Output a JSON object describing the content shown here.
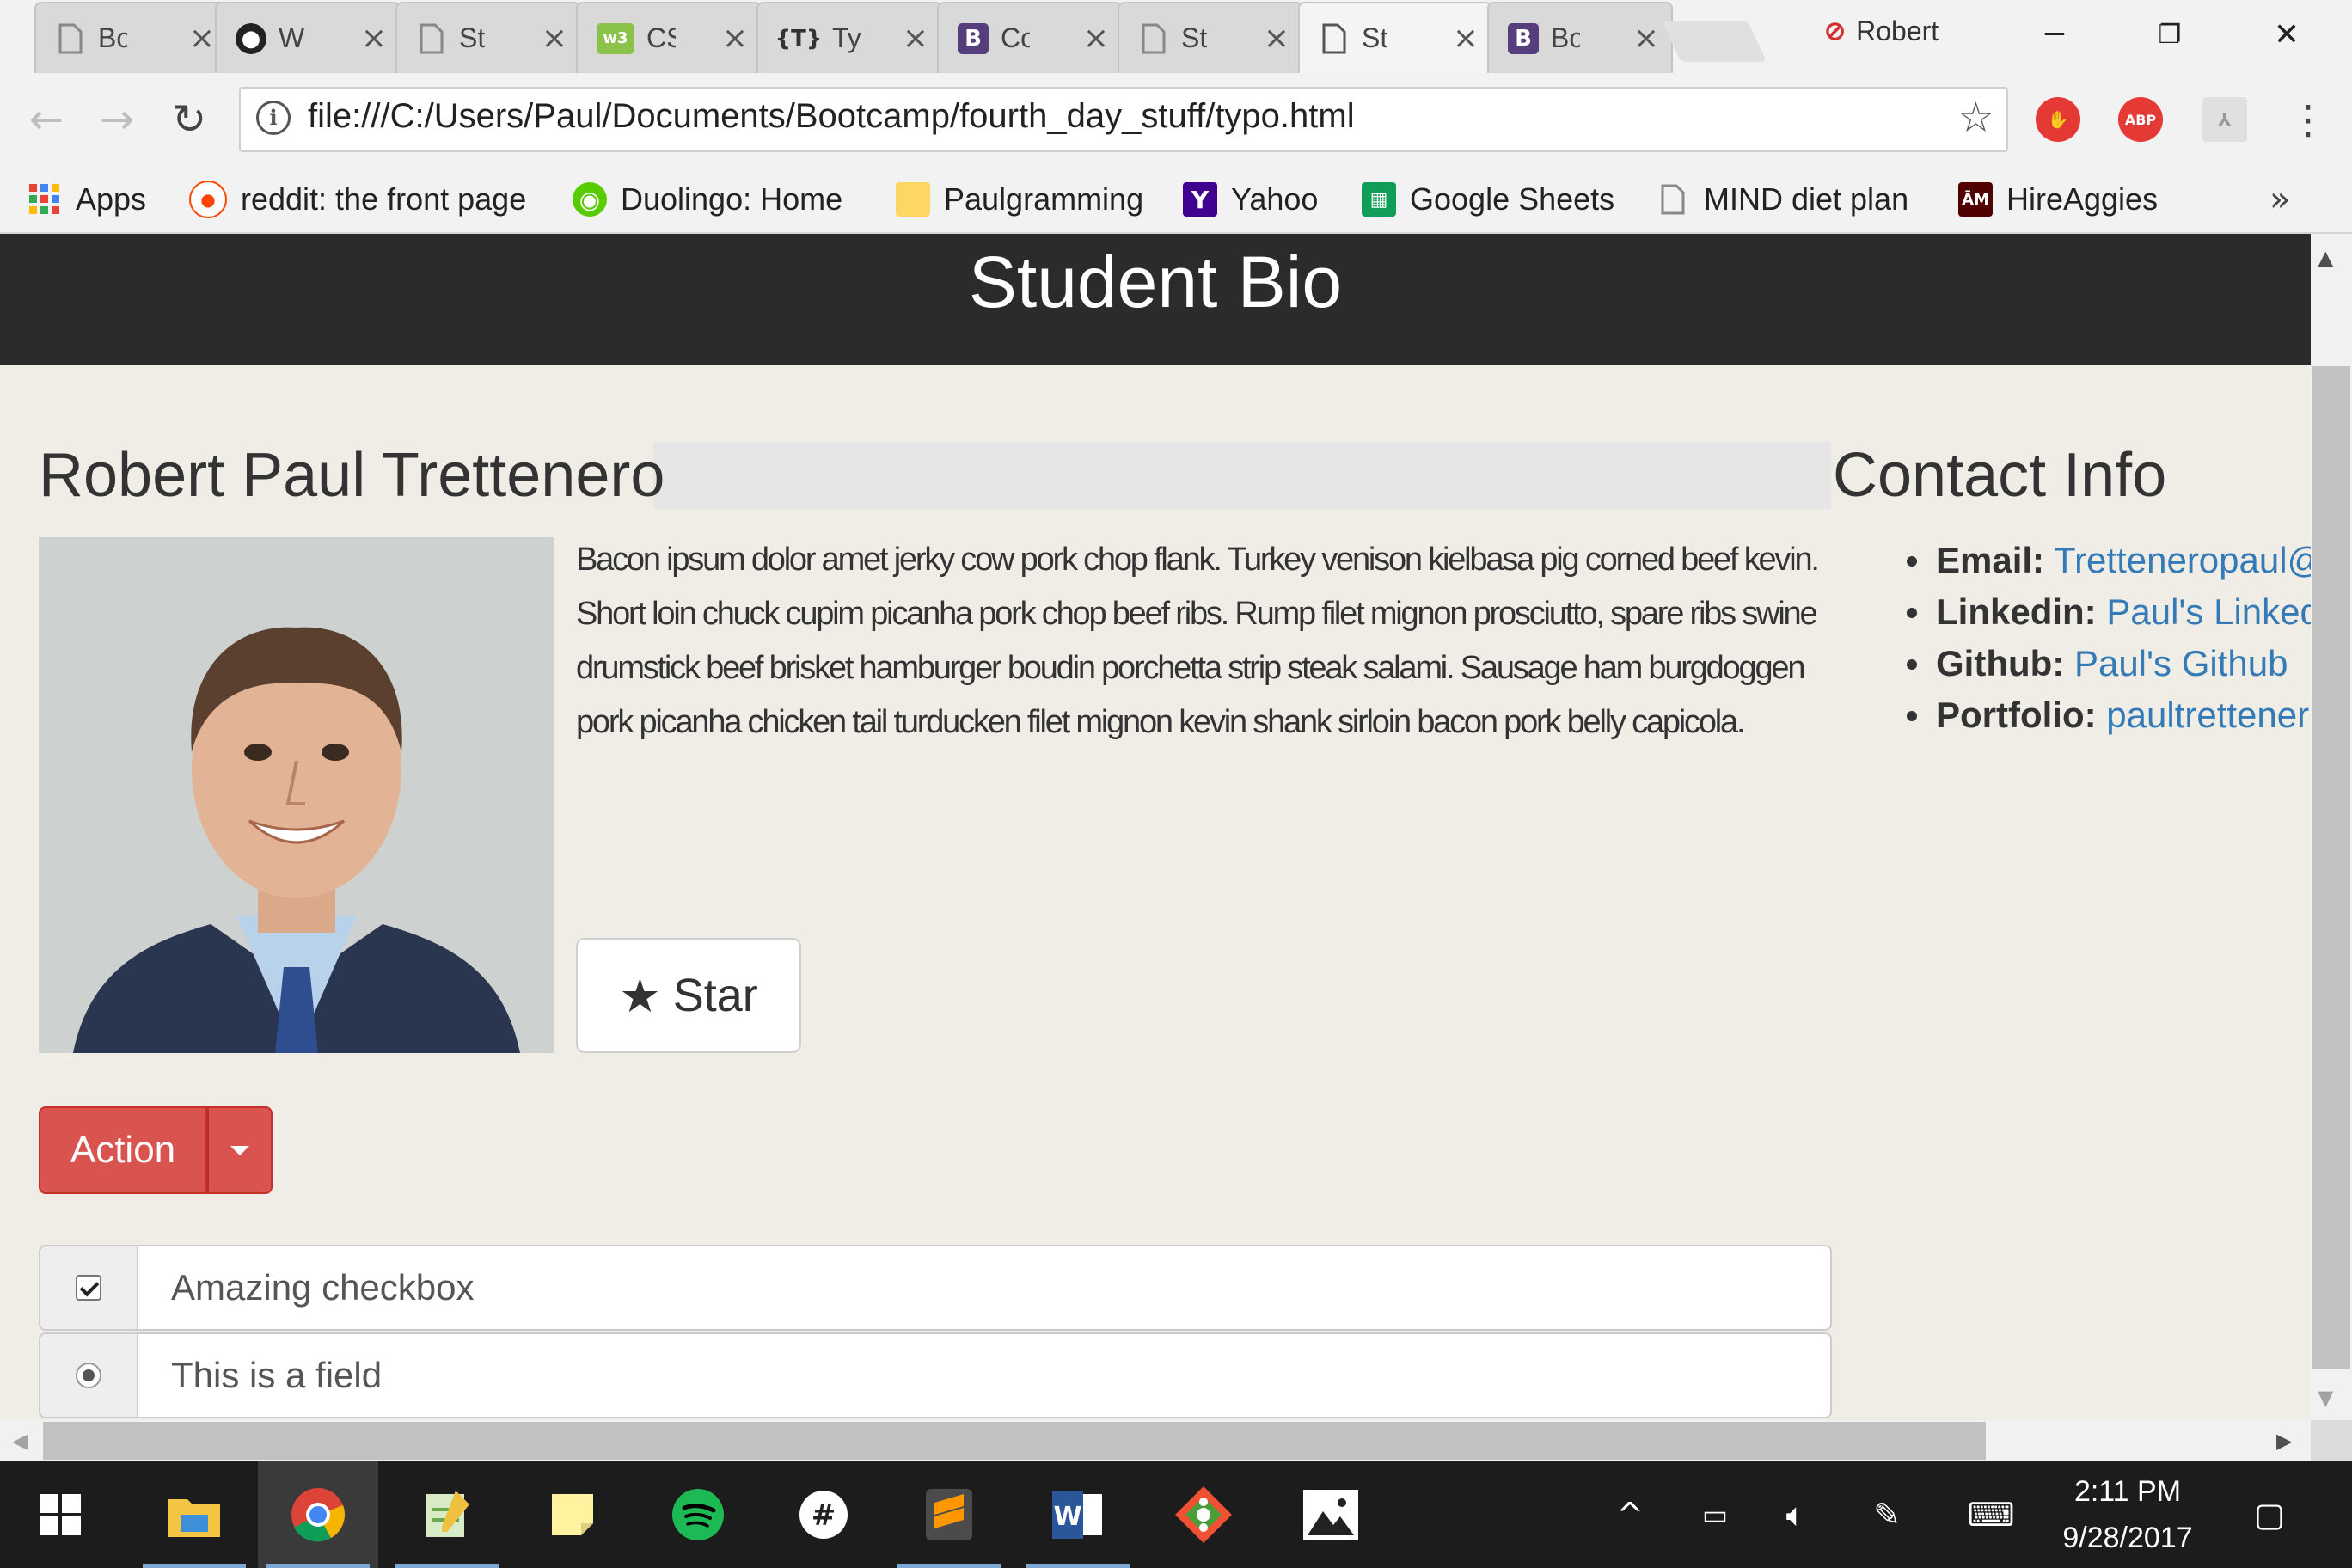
{
  "browser": {
    "tabs": [
      {
        "icon": "page-icon",
        "title": "Bo",
        "color": "#9e9e9e"
      },
      {
        "icon": "github-icon",
        "title": "W",
        "color": "#222222"
      },
      {
        "icon": "page-icon",
        "title": "St",
        "color": "#9e9e9e"
      },
      {
        "icon": "w3schools-icon",
        "title": "CS",
        "color": "#8bc34a"
      },
      {
        "icon": "typo-icon",
        "title": "Ty",
        "color": "#333333"
      },
      {
        "icon": "bootstrap-icon",
        "title": "Co",
        "color": "#563d7c"
      },
      {
        "icon": "page-icon",
        "title": "St",
        "color": "#9e9e9e"
      },
      {
        "icon": "page-icon",
        "title": "St",
        "color": "#9e9e9e",
        "active": true
      },
      {
        "icon": "bootstrap-icon",
        "title": "Bo",
        "color": "#563d7c"
      }
    ],
    "profile_name": "Robert",
    "url": "file:///C:/Users/Paul/Documents/Bootcamp/fourth_day_stuff/typo.html",
    "bookmarks": [
      {
        "label": "Apps",
        "icon": "apps-grid-icon"
      },
      {
        "label": "reddit: the front page",
        "icon": "reddit-icon"
      },
      {
        "label": "Duolingo: Home",
        "icon": "duolingo-icon"
      },
      {
        "label": "Paulgramming",
        "icon": "folder-icon"
      },
      {
        "label": "Yahoo",
        "icon": "yahoo-icon"
      },
      {
        "label": "Google Sheets",
        "icon": "sheets-icon"
      },
      {
        "label": "MIND diet plan",
        "icon": "page-icon"
      },
      {
        "label": "HireAggies",
        "icon": "tamu-icon"
      }
    ],
    "bookmarks_more": "»"
  },
  "page": {
    "title": "Student Bio",
    "name": "Robert Paul Trettenero",
    "bio": "Bacon ipsum dolor amet jerky cow pork chop flank. Turkey venison kielbasa pig corned beef kevin. Short loin chuck cupim picanha pork chop beef ribs. Rump filet mignon prosciutto, spare ribs swine drumstick beef brisket hamburger boudin porchetta strip steak salami. Sausage ham burgdoggen pork picanha chicken tail turducken filet mignon kevin shank sirloin bacon pork belly capicola.",
    "star_label": "Star",
    "action_label": "Action",
    "checkbox_field": "Amazing checkbox",
    "radio_field": "This is a field",
    "contact_heading": "Contact Info",
    "contact": [
      {
        "label": "Email:",
        "value": "Tretteneropaul@"
      },
      {
        "label": "Linkedin:",
        "value": "Paul's Linkedin"
      },
      {
        "label": "Github:",
        "value": "Paul's Github"
      },
      {
        "label": "Portfolio:",
        "value": "paultrettener"
      }
    ]
  },
  "taskbar": {
    "time": "2:11 PM",
    "date": "9/28/2017",
    "apps": [
      "start-icon",
      "file-explorer-icon",
      "chrome-icon",
      "notepad-icon",
      "sticky-notes-icon",
      "spotify-icon",
      "slack-icon",
      "sublime-icon",
      "word-icon",
      "git-icon",
      "photos-icon"
    ]
  },
  "colors": {
    "header_bg": "#2b2b2b",
    "page_bg": "#efede6",
    "danger": "#d9534f",
    "link": "#337ab7"
  }
}
